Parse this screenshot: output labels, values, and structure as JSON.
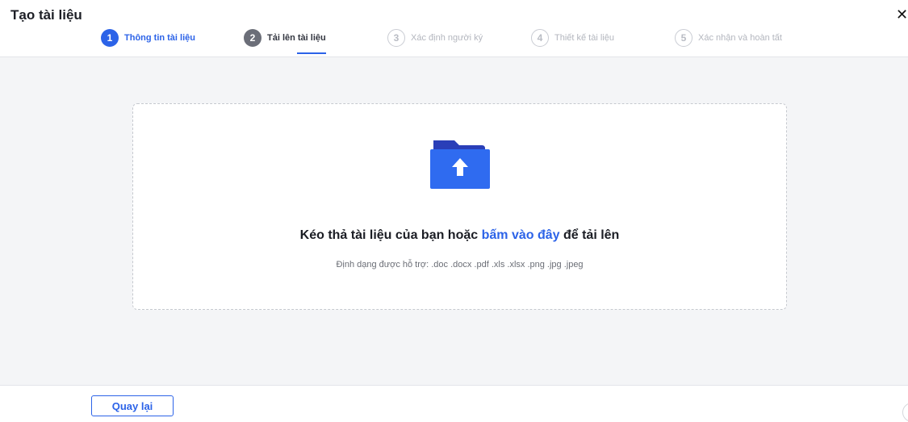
{
  "header": {
    "title": "Tạo tài liệu",
    "close_icon": "close-icon"
  },
  "steps": [
    {
      "number": "1",
      "label": "Thông tin tài liệu",
      "state": "completed"
    },
    {
      "number": "2",
      "label": "Tải lên tài liệu",
      "state": "current"
    },
    {
      "number": "3",
      "label": "Xác định người ký",
      "state": "pending"
    },
    {
      "number": "4",
      "label": "Thiết kế tài liệu",
      "state": "pending"
    },
    {
      "number": "5",
      "label": "Xác nhận và hoàn tất",
      "state": "pending"
    }
  ],
  "upload": {
    "icon": "folder-upload-icon",
    "text_before": "Kéo thả tài liệu của bạn hoặc ",
    "link_text": "bấm vào đây",
    "text_after": " để tải lên",
    "formats": "Định dạng được hỗ trợ: .doc .docx .pdf .xls .xlsx .png .jpg .jpeg"
  },
  "footer": {
    "back_label": "Quay lại"
  },
  "colors": {
    "accent": "#2c63e8",
    "folder_dark": "#2a3fb8",
    "folder_light": "#2f6bf0",
    "background": "#f4f5f7"
  }
}
